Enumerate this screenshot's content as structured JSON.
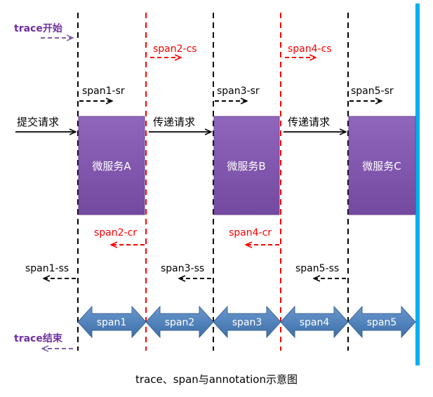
{
  "trace_labels": {
    "start": "trace开始",
    "end": "trace结束"
  },
  "services": [
    {
      "label": "微服务A",
      "incoming": "提交请求",
      "server_receive": "span1-sr",
      "server_send": "span1-ss"
    },
    {
      "label": "微服务B",
      "incoming": "传递请求",
      "server_receive": "span3-sr",
      "server_send": "span3-ss"
    },
    {
      "label": "微服务C",
      "incoming": "传递请求",
      "server_receive": "span5-sr",
      "server_send": "span5-ss"
    }
  ],
  "client_spans": [
    {
      "client_send": "span2-cs",
      "client_receive": "span2-cr"
    },
    {
      "client_send": "span4-cs",
      "client_receive": "span4-cr"
    }
  ],
  "spans": [
    "span1",
    "span2",
    "span3",
    "span4",
    "span5"
  ],
  "caption": "trace、span与annotation示意图",
  "colors": {
    "service_box": "#8052a8",
    "service_border": "#6a4592",
    "span_arrow": "#4f7fb8",
    "span_arrow_border": "#3b6493",
    "server_line": "#000000",
    "client_line": "#ff0000",
    "trace_label": "#7030a0",
    "trace_arrow": "#7f5fa8",
    "timeline_bar": "#00b0f0"
  }
}
